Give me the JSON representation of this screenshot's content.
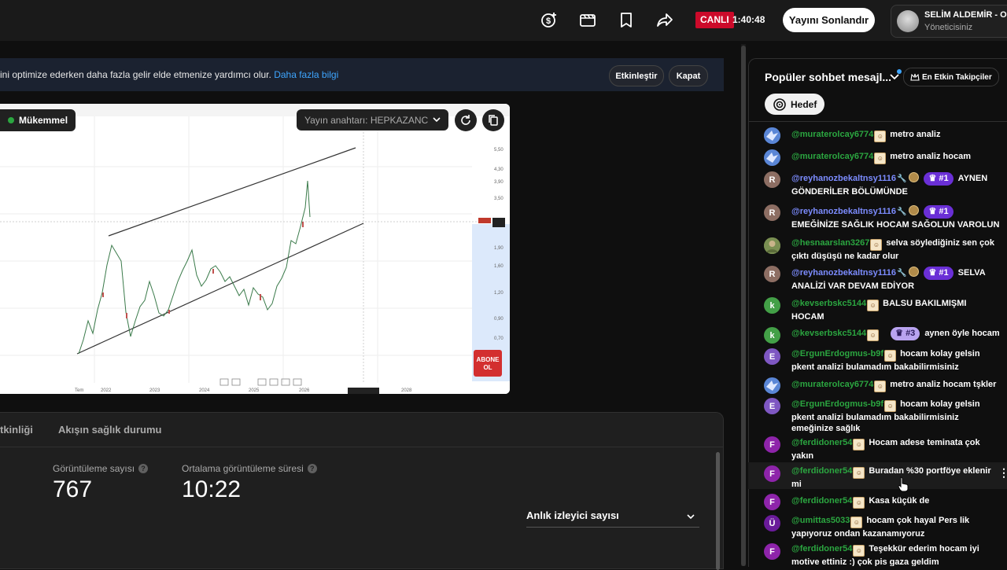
{
  "topbar": {
    "icons": [
      "monetization-icon",
      "clapperboard-icon",
      "bookmark-icon",
      "share-icon"
    ],
    "live_label": "CANLI",
    "live_time": "1:40:48",
    "end_stream_label": "Yayını Sonlandır",
    "channel_name": "SELİM ALDEMİR - Of",
    "channel_role": "Yöneticisiniz"
  },
  "banner": {
    "text": "ini optimize ederken daha fazla gelir elde etmenize yardımcı olur.",
    "link": "Daha fazla bilgi",
    "engage_label": "Etkinleştir",
    "close_label": "Kapat"
  },
  "preview": {
    "quality_label": "Mükemmel",
    "stream_key_label": "Yayın anahtarı: HEPKAZANC",
    "overlay_badge": [
      "ABONE",
      "OL"
    ]
  },
  "analytics": {
    "tabs": [
      "tkinliği",
      "Akışın sağlık durumu"
    ],
    "views_label": "Görüntüleme sayısı",
    "views_value": "767",
    "avg_label": "Ortalama görüntüleme süresi",
    "avg_value": "10:22",
    "select_label": "Anlık izleyici sayısı"
  },
  "chat": {
    "title": "Popüler sohbet mesajl...",
    "top_fans_label": "En Etkin Takipçiler",
    "goal_label": "Hedef",
    "messages": [
      {
        "initial": "",
        "author": "@muraterolcay6774",
        "rank": "",
        "text": "metro analiz"
      },
      {
        "initial": "",
        "author": "@muraterolcay6774",
        "rank": "",
        "text": "metro analiz hocam"
      },
      {
        "initial": "R",
        "author": "@reyhanozbekaltnsy1116",
        "rank": "#1",
        "text": "AYNEN GÖNDERİLER BÖLÜMÜNDE"
      },
      {
        "initial": "R",
        "author": "@reyhanozbekaltnsy1116",
        "rank": "#1",
        "text": "EMEĞİNİZE SAĞLIK HOCAM SAĞOLUN VAROLUN"
      },
      {
        "initial": "",
        "author": "@hesnaarslan3267",
        "rank": "",
        "text": "selva söylediğiniz sen çok çıktı düşüşü ne kadar olur"
      },
      {
        "initial": "R",
        "author": "@reyhanozbekaltnsy1116",
        "rank": "#1",
        "text": "SELVA ANALİZİ VAR DEVAM EDİYOR"
      },
      {
        "initial": "k",
        "author": "@kevserbskc5144",
        "rank": "",
        "text": "BALSU BAKILMIŞMI HOCAM"
      },
      {
        "initial": "k",
        "author": "@kevserbskc5144",
        "rank": "#3",
        "text": "aynen öyle hocam"
      },
      {
        "initial": "E",
        "author": "@ErgunErdogmus-b9f",
        "rank": "",
        "text": "hocam kolay gelsin pkent analizi bulamadım bakabilirmisiniz"
      },
      {
        "initial": "",
        "author": "@muraterolcay6774",
        "rank": "",
        "text": "metro analiz hocam tşkler"
      },
      {
        "initial": "E",
        "author": "@ErgunErdogmus-b9f",
        "rank": "",
        "text": "hocam kolay gelsin pkent analizi bulamadım bakabilirmisiniz emeğinize sağlık"
      },
      {
        "initial": "F",
        "author": "@ferdidoner54",
        "rank": "",
        "text": "Hocam adese teminata çok yakın"
      },
      {
        "initial": "F",
        "author": "@ferdidoner54",
        "rank": "",
        "text": "Buradan %30 portföye eklenir mi"
      },
      {
        "initial": "F",
        "author": "@ferdidoner54",
        "rank": "",
        "text": "Kasa küçük de"
      },
      {
        "initial": "Ü",
        "author": "@umittas5033",
        "rank": "",
        "text": "hocam çok hayal Pers lik yapıyoruz ondan kazanamıyoruz"
      },
      {
        "initial": "F",
        "author": "@ferdidoner54",
        "rank": "",
        "text": "Teşekkür ederim hocam iyi motive ettiniz :) çok pis gaza geldim"
      }
    ]
  }
}
